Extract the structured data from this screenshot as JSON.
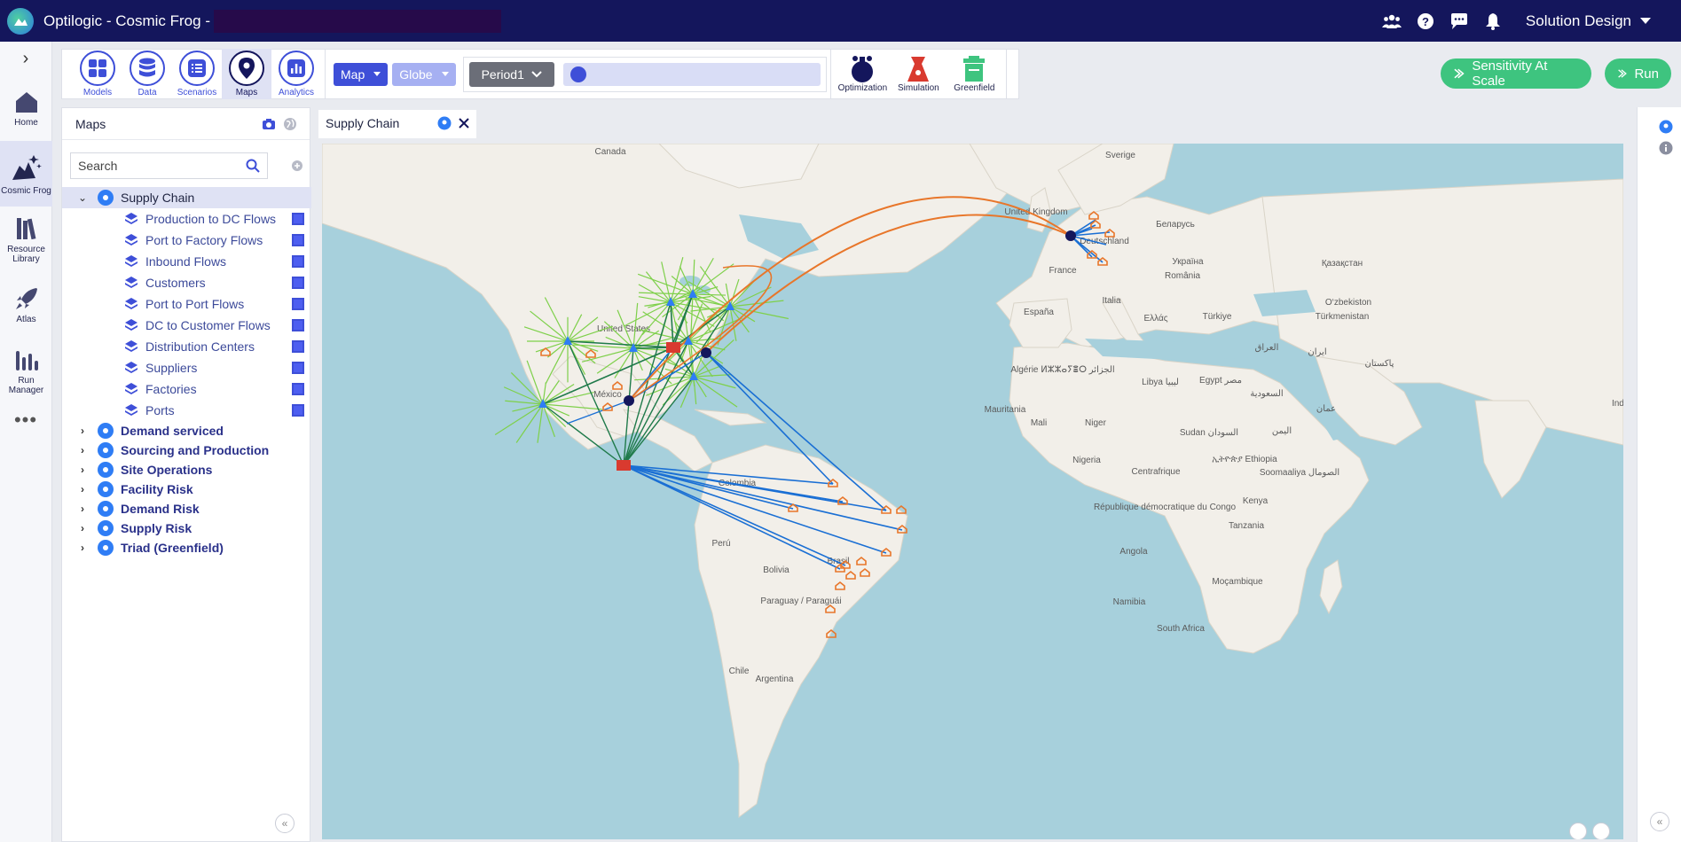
{
  "app": {
    "title": "Optilogic - Cosmic Frog -",
    "workspace": "Solution Design"
  },
  "topbar": {
    "icons": [
      "team-icon",
      "help-icon",
      "chat-icon",
      "bell-icon"
    ]
  },
  "leftnav": {
    "items": [
      {
        "label": "Home",
        "icon": "home-icon"
      },
      {
        "label": "Cosmic Frog",
        "icon": "cosmic-frog-icon"
      },
      {
        "label": "Resource Library",
        "icon": "library-icon"
      },
      {
        "label": "Atlas",
        "icon": "rocket-icon"
      },
      {
        "label": "Run Manager",
        "icon": "bar-chart-icon"
      }
    ],
    "more": "•••"
  },
  "toolbar": {
    "tools": [
      {
        "label": "Models",
        "icon": "grid-icon"
      },
      {
        "label": "Data",
        "icon": "database-icon"
      },
      {
        "label": "Scenarios",
        "icon": "list-icon"
      },
      {
        "label": "Maps",
        "icon": "map-pin-icon"
      },
      {
        "label": "Analytics",
        "icon": "analytics-icon"
      }
    ],
    "map_dropdown": "Map",
    "globe_dropdown": "Globe",
    "period": "Period1",
    "engines": [
      {
        "label": "Optimization",
        "color": "#14165c"
      },
      {
        "label": "Simulation",
        "color": "#d93a2f"
      },
      {
        "label": "Greenfield",
        "color": "#3ec47f"
      }
    ],
    "sensitivity_label": "Sensitivity At Scale",
    "run_label": "Run"
  },
  "maps_panel": {
    "title": "Maps",
    "search_placeholder": "Search",
    "tree": [
      {
        "label": "Supply Chain",
        "expanded": true,
        "layers": [
          "Production to DC Flows",
          "Port to Factory Flows",
          "Inbound Flows",
          "Customers",
          "Port to Port Flows",
          "DC to Customer Flows",
          "Distribution Centers",
          "Suppliers",
          "Factories",
          "Ports"
        ]
      },
      {
        "label": "Demand serviced"
      },
      {
        "label": "Sourcing and Production"
      },
      {
        "label": "Site Operations"
      },
      {
        "label": "Facility Risk"
      },
      {
        "label": "Demand Risk"
      },
      {
        "label": "Supply Risk"
      },
      {
        "label": "Triad (Greenfield)"
      }
    ]
  },
  "map_tab": {
    "label": "Supply Chain"
  },
  "map_labels": {
    "canada": "Canada",
    "united_states": "United States",
    "mexico": "México",
    "colombia": "Colombia",
    "peru": "Perú",
    "bolivia": "Bolivia",
    "brasil": "Brasil",
    "paraguay": "Paraguay / Paraguái",
    "chile": "Chile",
    "argentina": "Argentina",
    "sverige": "Sverige",
    "uk": "United Kingdom",
    "deutschland": "Deutschland",
    "france": "France",
    "espana": "España",
    "italia": "Italia",
    "belarus": "Беларусь",
    "ukraine": "Україна",
    "kazakhstan": "Қазақстан",
    "romania": "România",
    "turkiye": "Türkiye",
    "ellas": "Ελλάς",
    "turkmenistan": "Türkmenistan",
    "uzbekistan": "O‘zbekiston",
    "iraq": "العراق",
    "iran": "ایران",
    "pakistan": "پاکستان",
    "egypt": "Egypt مصر",
    "libya": "Libya ليبيا",
    "algeria": "Algérie ⵍⵣⵣⴰⵢⴻⵔ الجزائر",
    "saudi": "السعودية",
    "oman": "عمان",
    "mauritania": "Mauritania",
    "mali": "Mali",
    "niger": "Niger",
    "sudan": "Sudan السودان",
    "yemen": "اليمن",
    "nigeria": "Nigeria",
    "ethiopia": "ኢትዮጵያ Ethiopia",
    "somalia": "Soomaaliya الصومال",
    "centrafrique": "Centrafrique",
    "rdc": "République démocratique du Congo",
    "kenya": "Kenya",
    "tanzania": "Tanzania",
    "angola": "Angola",
    "mozambique": "Moçambique",
    "namibia": "Namibia",
    "south_africa": "South Africa",
    "india": "Indi"
  },
  "colors": {
    "navy": "#14165c",
    "accent": "#3e4fd8",
    "green": "#3ec47f",
    "water": "#a7d0dc",
    "land": "#f2efe9",
    "flow_blue": "#1a6fd4",
    "flow_darkgreen": "#1f7a4a",
    "flow_lightgreen": "#7ed04a",
    "flow_orange": "#e8762a"
  }
}
